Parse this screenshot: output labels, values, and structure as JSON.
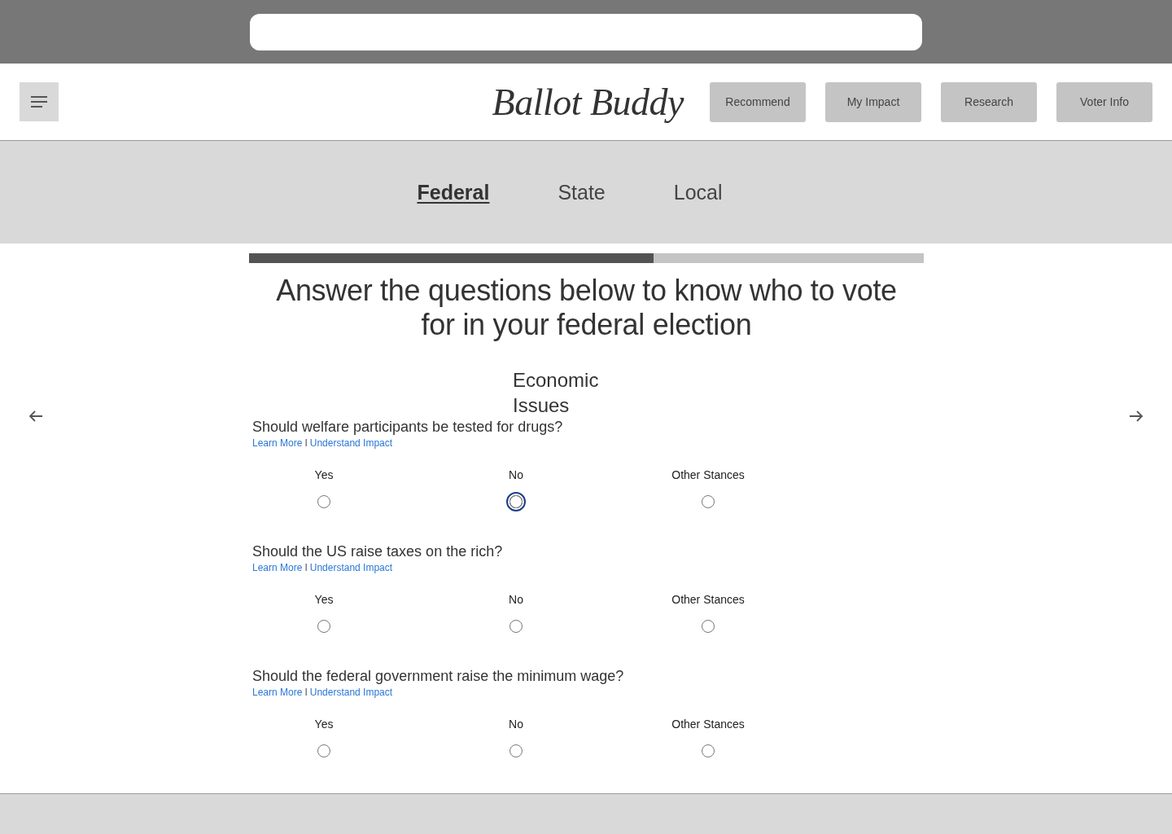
{
  "header": {
    "logo": "Ballot Buddy",
    "nav_buttons": [
      "Recommend",
      "My Impact",
      "Research",
      "Voter Info"
    ]
  },
  "tabs": [
    {
      "label": "Federal",
      "selected": true
    },
    {
      "label": "State",
      "selected": false
    },
    {
      "label": "Local",
      "selected": false
    }
  ],
  "progress": {
    "level": 0.6
  },
  "heading": "Answer the questions below to know who to vote for in your federal election",
  "section_title": "Economic Issues",
  "questions": [
    {
      "text": "Should welfare participants be tested for drugs?",
      "links": [
        "Learn More",
        "Understand Impact"
      ],
      "separator": "I",
      "options": [
        {
          "label": "Yes",
          "selected": false
        },
        {
          "label": "No",
          "selected": true
        },
        {
          "label": "Other Stances",
          "selected": false
        }
      ]
    },
    {
      "text": "Should the US raise taxes on the rich?",
      "links": [
        "Learn More",
        "Understand Impact"
      ],
      "separator": "I",
      "options": [
        {
          "label": "Yes",
          "selected": false
        },
        {
          "label": "No",
          "selected": false
        },
        {
          "label": "Other Stances",
          "selected": false
        }
      ]
    },
    {
      "text": "Should the federal government raise the minimum wage?",
      "links": [
        "Learn More",
        "Understand Impact"
      ],
      "separator": "I",
      "options": [
        {
          "label": "Yes",
          "selected": false
        },
        {
          "label": "No",
          "selected": false
        },
        {
          "label": "Other Stances",
          "selected": false
        }
      ]
    }
  ]
}
